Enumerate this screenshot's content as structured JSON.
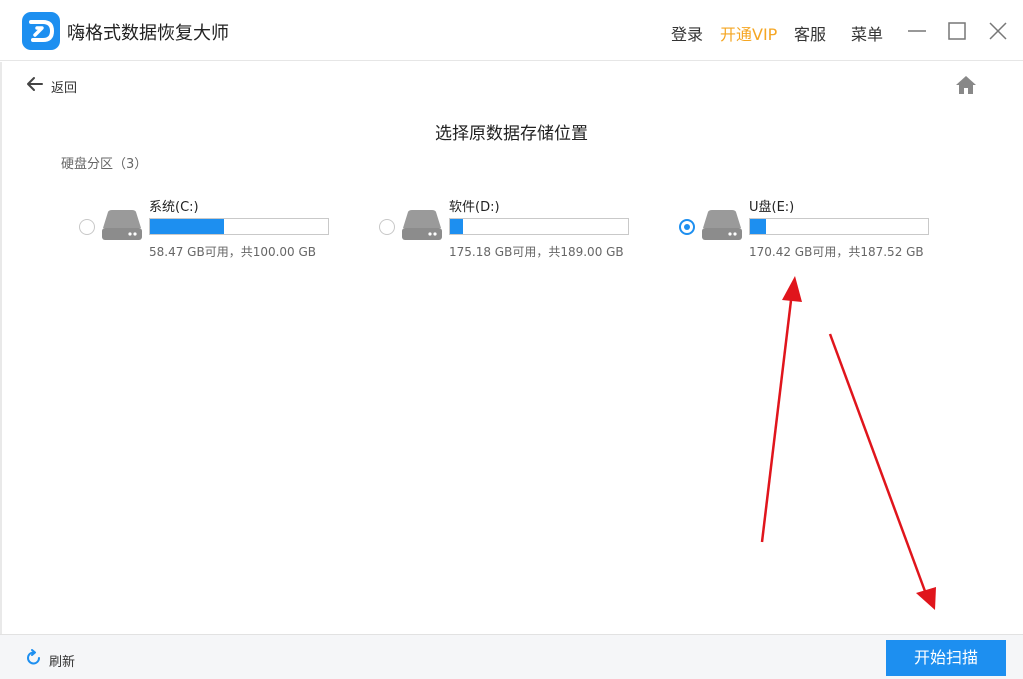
{
  "app": {
    "title": "嗨格式数据恢复大师",
    "logo_icon": "d-logo-icon",
    "brand_color": "#1d8ff0"
  },
  "header": {
    "login": "登录",
    "vip": "开通VIP",
    "vip_color": "#f5a623",
    "service": "客服",
    "menu": "菜单",
    "window_controls": [
      "minimize-icon",
      "maximize-icon",
      "close-icon"
    ]
  },
  "nav": {
    "back_label": "返回",
    "home_icon": "home-icon"
  },
  "page": {
    "title": "选择原数据存储位置",
    "section_label": "硬盘分区（3）"
  },
  "drives": [
    {
      "name": "系统(C:)",
      "size_text": "58.47 GB可用，共100.00 GB",
      "used_fraction": 0.415,
      "selected": false
    },
    {
      "name": "软件(D:)",
      "size_text": "175.18 GB可用，共189.00 GB",
      "used_fraction": 0.073,
      "selected": false
    },
    {
      "name": "U盘(E:)",
      "size_text": "170.42 GB可用，共187.52 GB",
      "used_fraction": 0.091,
      "selected": true
    }
  ],
  "footer": {
    "refresh_label": "刷新",
    "start_label": "开始扫描"
  },
  "annotations": {
    "arrow_color": "#e0151c"
  }
}
